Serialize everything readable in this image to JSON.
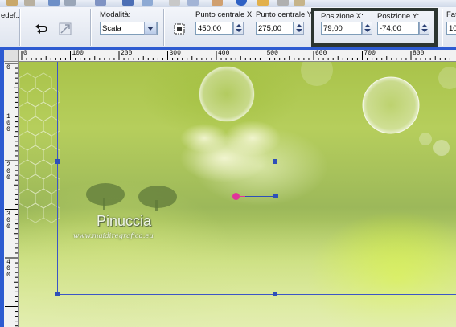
{
  "toolbar": {
    "preset_label": "edef.:",
    "mode_label": "Modalità:",
    "mode_value": "Scala",
    "center_x_label": "Punto centrale X:",
    "center_x_value": "450,00",
    "center_y_label": "Punto centrale Y",
    "center_y_value": "275,00",
    "pos_x_label": "Posizione X:",
    "pos_x_value": "79,00",
    "pos_y_label": "Posizione Y:",
    "pos_y_value": "-74,00",
    "fattore_label": "Fat",
    "fattore_value": "10"
  },
  "ruler_top": [
    "0",
    "100",
    "200",
    "300",
    "400",
    "500",
    "600",
    "700",
    "800"
  ],
  "ruler_left": [
    [
      "0"
    ],
    [
      "1",
      "0",
      "0"
    ],
    [
      "2",
      "0",
      "0"
    ],
    [
      "3",
      "0",
      "0"
    ],
    [
      "4",
      "0",
      "0"
    ]
  ],
  "canvas": {
    "watermark_name": "Pinuccia",
    "watermark_url": "www.maidiregrafica.eu"
  },
  "colors": {
    "highlight_border": "#2c3530",
    "frame_blue": "#2d5bd1",
    "handle_blue": "#2e4fb8",
    "pivot_magenta": "#e0359a",
    "selection_line": "#3c55c6"
  },
  "icons": [
    "undo-redo-icon",
    "reset-icon",
    "center-icon",
    "up-arrow",
    "down-arrow",
    "dropdown-arrow"
  ]
}
